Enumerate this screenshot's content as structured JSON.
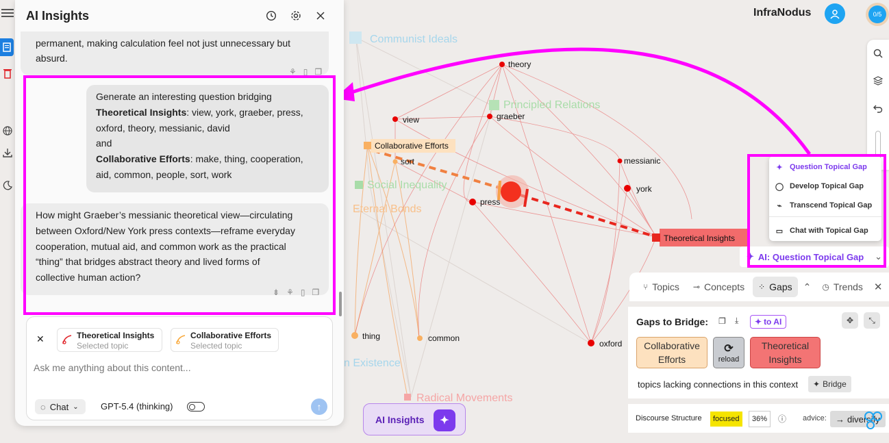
{
  "app": {
    "brand": "InfraNodus",
    "quota": "0/5"
  },
  "panel": {
    "title": "AI Insights",
    "prev_message": {
      "line1": "permanent, making calculation feel not just unnecessary but",
      "line2": "absurd."
    },
    "user_message": {
      "intro": "Generate an interesting question bridging",
      "topic1_name": "Theoretical Insights",
      "topic1_words_a": ": view, york, graeber, press,",
      "topic1_words_b": "oxford, theory, messianic, david",
      "and": "and",
      "topic2_name": "Collaborative Efforts",
      "topic2_words_a": ": make, thing, cooperation,",
      "topic2_words_b": "aid, common, people, sort, work"
    },
    "ai_message": {
      "l1": "How might Graeber’s messianic theoretical view—circulating",
      "l2": "between Oxford/New York press contexts—reframe everyday",
      "l3": "cooperation, mutual aid, and common work as the practical",
      "l4": "“thing” that bridges abstract theory and lived forms of",
      "l5": "collective human action?"
    },
    "chips": [
      {
        "title": "Theoretical Insights",
        "sub": "Selected topic"
      },
      {
        "title": "Collaborative Efforts",
        "sub": "Selected topic"
      }
    ],
    "input_placeholder": "Ask me anything about this content...",
    "mode": "Chat",
    "model": "GPT-5.4 (thinking)"
  },
  "ai_button": "AI Insights",
  "dropdown": {
    "items": [
      "Question Topical Gap",
      "Develop Topical Gap",
      "Transcend Topical Gap",
      "Chat with Topical Gap"
    ],
    "selected": "AI: Question Topical Gap"
  },
  "tabs": [
    "Topics",
    "Concepts",
    "Gaps",
    "Trends"
  ],
  "gaps": {
    "title": "Gaps to Bridge:",
    "to_ai": "to AI",
    "card1": "Collaborative Efforts",
    "reload": "reload",
    "card2": "Theoretical Insights",
    "description": "topics lacking connections in this context",
    "bridge": "Bridge"
  },
  "discourse": {
    "label": "Discourse Structure",
    "status": "focused",
    "percent": "36%",
    "advice_label": "advice:",
    "advice": "diversify"
  },
  "graph": {
    "topics": [
      {
        "label": "Communist Ideals",
        "color": "#9fd3ea"
      },
      {
        "label": "Principled Relations",
        "color": "#8ed08e"
      },
      {
        "label": "Collaborative Efforts",
        "color": "#f9b062"
      },
      {
        "label": "Social Inequality",
        "color": "#8ed08e"
      },
      {
        "label": "Eternal Bonds",
        "color": "#f9b062"
      },
      {
        "label": "Theoretical Insights",
        "color": "#f26b6b"
      },
      {
        "label": "n Existence",
        "color": "#9fd3ea"
      },
      {
        "label": "Radical Movements",
        "color": "#f48a8a"
      }
    ],
    "nodes": [
      {
        "label": "theory"
      },
      {
        "label": "view"
      },
      {
        "label": "graeber"
      },
      {
        "label": "sort"
      },
      {
        "label": "messianic"
      },
      {
        "label": "york"
      },
      {
        "label": "press"
      },
      {
        "label": "thing"
      },
      {
        "label": "common"
      },
      {
        "label": "oxford"
      }
    ]
  }
}
